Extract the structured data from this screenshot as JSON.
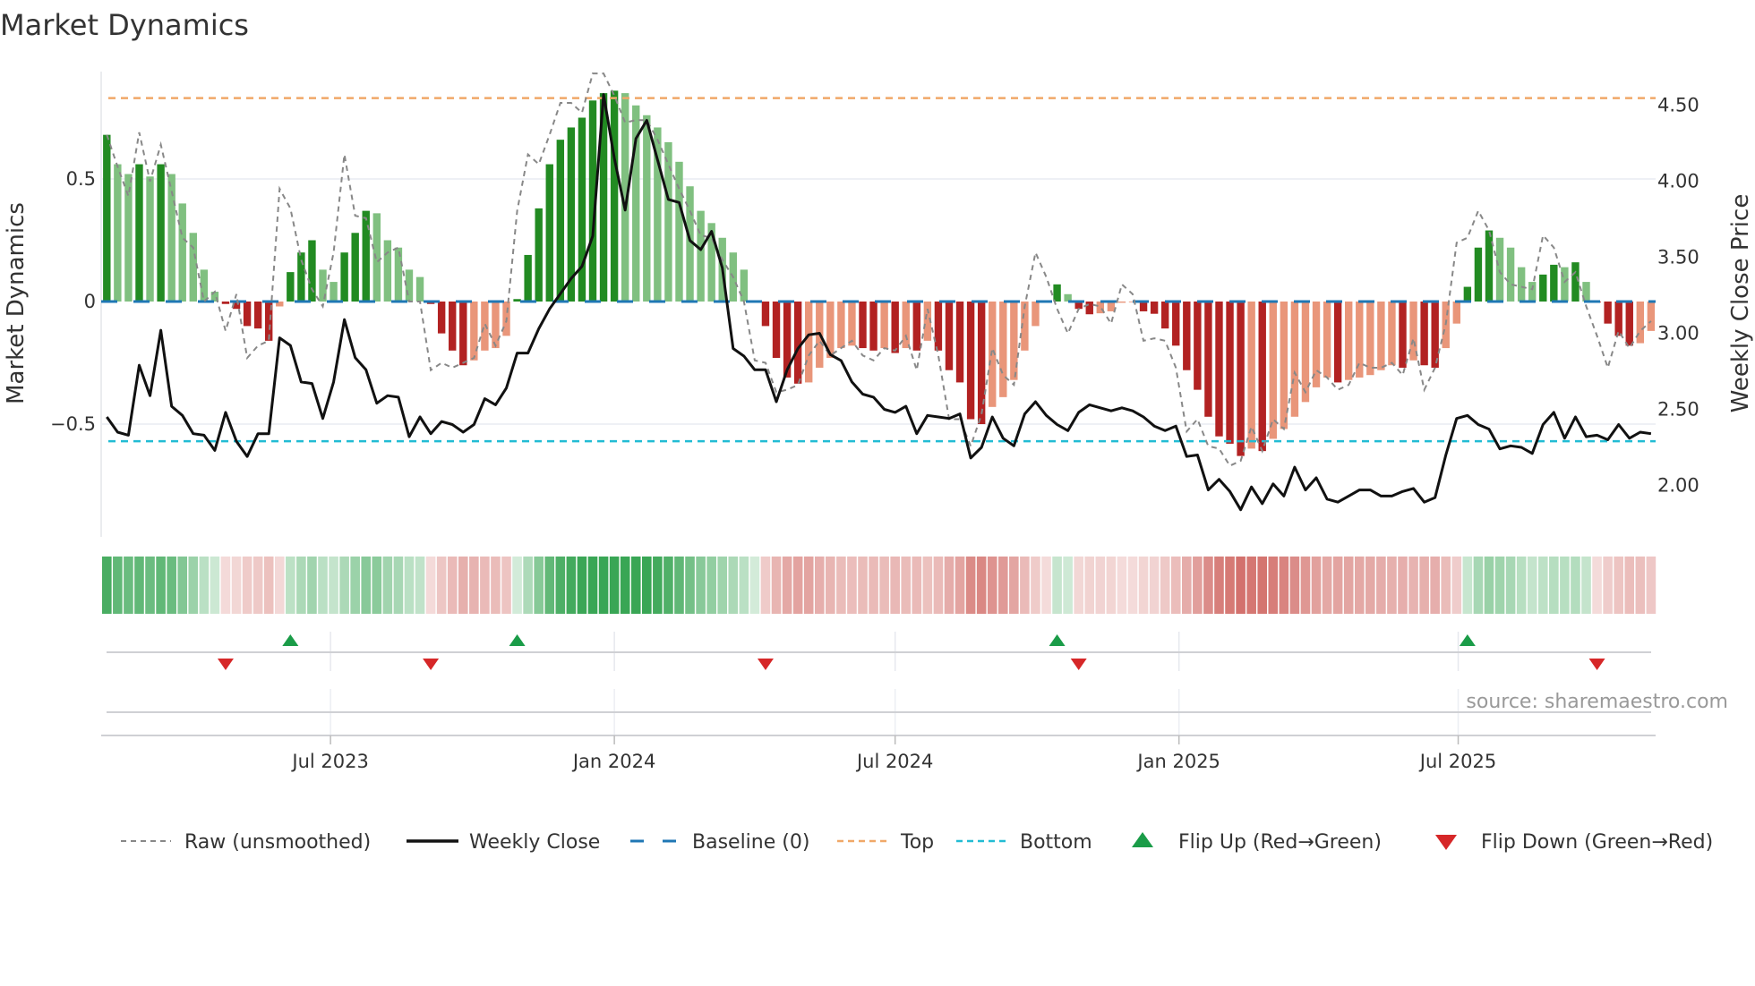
{
  "chart_data": {
    "type": "bar",
    "title": "Market Dynamics",
    "ylabel": "Market Dynamics",
    "ylabel_right": "Weekly Close Price",
    "xlabel": "",
    "source": "source: sharemaestro.com",
    "frequency": "weekly",
    "x_start": "2023-02-06",
    "ylim": [
      -0.96,
      0.94
    ],
    "ylim_right": [
      1.66,
      4.72
    ],
    "y_ticks": [
      {
        "value": 0.5,
        "label": "0.5"
      },
      {
        "value": 0,
        "label": "0"
      },
      {
        "value": -0.5,
        "label": "−0.5"
      }
    ],
    "y_ticks_right": [
      {
        "value": 2.0,
        "label": "2.00"
      },
      {
        "value": 2.5,
        "label": "2.50"
      },
      {
        "value": 3.0,
        "label": "3.00"
      },
      {
        "value": 3.5,
        "label": "3.50"
      },
      {
        "value": 4.0,
        "label": "4.00"
      },
      {
        "value": 4.5,
        "label": "4.50"
      }
    ],
    "x_ticks": [
      {
        "label": "Jul 2023",
        "date": "2023-07-01"
      },
      {
        "label": "Jan 2024",
        "date": "2024-01-01"
      },
      {
        "label": "Jul 2024",
        "date": "2024-07-01"
      },
      {
        "label": "Jan 2025",
        "date": "2025-01-01"
      },
      {
        "label": "Jul 2025",
        "date": "2025-07-01"
      }
    ],
    "top_level": 0.83,
    "bottom_level": -0.57,
    "baseline": 0,
    "series": [
      {
        "name": "Market Dynamics (smoothed)",
        "values": [
          0.68,
          0.56,
          0.52,
          0.56,
          0.51,
          0.56,
          0.52,
          0.4,
          0.28,
          0.13,
          0.04,
          -0.01,
          -0.03,
          -0.1,
          -0.11,
          -0.16,
          -0.02,
          0.12,
          0.2,
          0.25,
          0.13,
          0.08,
          0.2,
          0.28,
          0.37,
          0.36,
          0.25,
          0.22,
          0.13,
          0.1,
          -0.01,
          -0.13,
          -0.2,
          -0.26,
          -0.24,
          -0.2,
          -0.19,
          -0.14,
          0.01,
          0.19,
          0.38,
          0.56,
          0.66,
          0.71,
          0.75,
          0.82,
          0.85,
          0.86,
          0.85,
          0.8,
          0.76,
          0.71,
          0.65,
          0.57,
          0.47,
          0.37,
          0.32,
          0.26,
          0.2,
          0.13,
          0.004,
          -0.1,
          -0.23,
          -0.31,
          -0.335,
          -0.33,
          -0.27,
          -0.23,
          -0.19,
          -0.18,
          -0.19,
          -0.2,
          -0.19,
          -0.21,
          -0.19,
          -0.2,
          -0.16,
          -0.2,
          -0.28,
          -0.33,
          -0.48,
          -0.5,
          -0.43,
          -0.39,
          -0.32,
          -0.2,
          -0.1,
          -0.005,
          0.07,
          0.03,
          -0.03,
          -0.052,
          -0.048,
          -0.04,
          -0.005,
          -0.003,
          -0.04,
          -0.05,
          -0.11,
          -0.18,
          -0.28,
          -0.36,
          -0.47,
          -0.55,
          -0.58,
          -0.63,
          -0.6,
          -0.61,
          -0.56,
          -0.52,
          -0.47,
          -0.41,
          -0.35,
          -0.31,
          -0.33,
          -0.32,
          -0.31,
          -0.3,
          -0.28,
          -0.26,
          -0.27,
          -0.24,
          -0.26,
          -0.27,
          -0.19,
          -0.09,
          0.06,
          0.22,
          0.29,
          0.26,
          0.22,
          0.14,
          0.08,
          0.11,
          0.15,
          0.14,
          0.16,
          0.08,
          -0.004,
          -0.09,
          -0.14,
          -0.18,
          -0.17,
          -0.12
        ]
      },
      {
        "name": "Raw (unsmoothed)",
        "values": [
          0.68,
          0.55,
          0.43,
          0.69,
          0.49,
          0.64,
          0.45,
          0.26,
          0.22,
          0.0,
          0.04,
          -0.12,
          0.03,
          -0.23,
          -0.18,
          -0.16,
          0.46,
          0.38,
          0.17,
          0.05,
          -0.02,
          0.2,
          0.6,
          0.35,
          0.34,
          0.16,
          0.2,
          0.22,
          0.0,
          0.0,
          -0.28,
          -0.25,
          -0.27,
          -0.25,
          -0.23,
          -0.09,
          -0.18,
          -0.08,
          0.37,
          0.6,
          0.56,
          0.68,
          0.81,
          0.81,
          0.77,
          0.93,
          0.93,
          0.84,
          0.73,
          0.74,
          0.74,
          0.66,
          0.56,
          0.46,
          0.37,
          0.27,
          0.26,
          0.17,
          0.1,
          0.0,
          -0.24,
          -0.25,
          -0.37,
          -0.36,
          -0.34,
          -0.22,
          -0.16,
          -0.22,
          -0.19,
          -0.16,
          -0.22,
          -0.24,
          -0.19,
          -0.2,
          -0.14,
          -0.28,
          -0.03,
          -0.22,
          -0.48,
          -0.48,
          -0.59,
          -0.46,
          -0.19,
          -0.3,
          -0.34,
          -0.02,
          0.2,
          0.1,
          -0.03,
          -0.13,
          -0.03,
          -0.01,
          -0.02,
          -0.09,
          0.07,
          0.03,
          -0.16,
          -0.15,
          -0.16,
          -0.27,
          -0.53,
          -0.48,
          -0.59,
          -0.6,
          -0.67,
          -0.65,
          -0.51,
          -0.61,
          -0.48,
          -0.52,
          -0.29,
          -0.37,
          -0.28,
          -0.31,
          -0.36,
          -0.34,
          -0.25,
          -0.27,
          -0.27,
          -0.25,
          -0.3,
          -0.15,
          -0.36,
          -0.27,
          -0.09,
          0.24,
          0.26,
          0.37,
          0.29,
          0.12,
          0.07,
          0.06,
          0.05,
          0.27,
          0.22,
          0.08,
          0.12,
          -0.02,
          -0.14,
          -0.27,
          -0.12,
          -0.19,
          -0.12,
          -0.08
        ]
      },
      {
        "name": "Weekly Close",
        "axis": "right",
        "values": [
          2.45,
          2.35,
          2.33,
          2.79,
          2.59,
          3.02,
          2.52,
          2.46,
          2.34,
          2.33,
          2.23,
          2.48,
          2.29,
          2.19,
          2.34,
          2.34,
          2.97,
          2.92,
          2.68,
          2.67,
          2.44,
          2.68,
          3.09,
          2.84,
          2.76,
          2.54,
          2.59,
          2.58,
          2.32,
          2.45,
          2.34,
          2.42,
          2.4,
          2.35,
          2.4,
          2.57,
          2.53,
          2.64,
          2.87,
          2.87,
          3.03,
          3.16,
          3.26,
          3.36,
          3.44,
          3.64,
          4.57,
          4.15,
          3.81,
          4.28,
          4.4,
          4.14,
          3.88,
          3.86,
          3.61,
          3.55,
          3.67,
          3.43,
          2.9,
          2.85,
          2.76,
          2.76,
          2.55,
          2.76,
          2.9,
          2.99,
          3.0,
          2.86,
          2.82,
          2.68,
          2.6,
          2.58,
          2.5,
          2.48,
          2.52,
          2.34,
          2.46,
          2.45,
          2.44,
          2.47,
          2.18,
          2.25,
          2.45,
          2.31,
          2.26,
          2.47,
          2.55,
          2.46,
          2.4,
          2.36,
          2.48,
          2.53,
          2.51,
          2.49,
          2.51,
          2.49,
          2.45,
          2.39,
          2.36,
          2.39,
          2.19,
          2.2,
          1.97,
          2.04,
          1.96,
          1.84,
          1.99,
          1.88,
          2.01,
          1.93,
          2.12,
          1.97,
          2.05,
          1.91,
          1.89,
          1.93,
          1.97,
          1.97,
          1.93,
          1.93,
          1.96,
          1.98,
          1.89,
          1.92,
          2.2,
          2.44,
          2.46,
          2.4,
          2.37,
          2.24,
          2.26,
          2.25,
          2.21,
          2.4,
          2.48,
          2.31,
          2.45,
          2.32,
          2.33,
          2.3,
          2.4,
          2.31,
          2.35,
          2.34
        ]
      }
    ],
    "flip_up_weeks": [
      17,
      38,
      88,
      126
    ],
    "flip_down_weeks": [
      11,
      30,
      61,
      90,
      138
    ],
    "legend": {
      "position": "bottom",
      "items": [
        {
          "key": "raw",
          "label": "Raw (unsmoothed)"
        },
        {
          "key": "close",
          "label": "Weekly Close"
        },
        {
          "key": "baseline",
          "label": "Baseline (0)"
        },
        {
          "key": "top",
          "label": "Top"
        },
        {
          "key": "bottom",
          "label": "Bottom"
        },
        {
          "key": "flip_up",
          "label": "Flip Up (Red→Green)"
        },
        {
          "key": "flip_down",
          "label": "Flip Down (Green→Red)"
        }
      ]
    },
    "colors": {
      "pos_rising": "#228b22",
      "pos_falling": "#80c080",
      "neg_falling": "#b22222",
      "neg_rising": "#e9967a",
      "raw": "#888888",
      "close": "#111111",
      "baseline": "#1f77b4",
      "top": "#f0a868",
      "bottom": "#22bcd4",
      "flip_up": "#1a9c48",
      "flip_down": "#d62728"
    }
  }
}
